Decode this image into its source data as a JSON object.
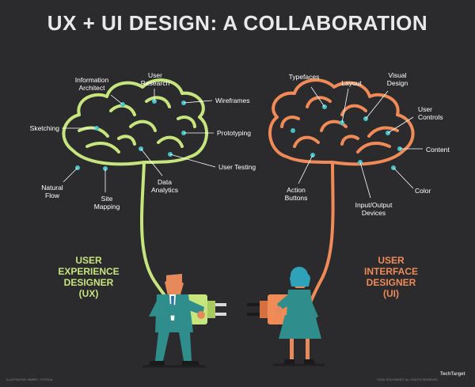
{
  "title": "UX + UI DESIGN: A COLLABORATION",
  "colors": {
    "background": "#2b2b2d",
    "ux_brain": "#c6e57d",
    "ui_brain": "#f08a57",
    "dot": "#46c2c6",
    "label": "#ffffff",
    "title": "#e9e9e9"
  },
  "ux": {
    "role_label": "USER\nEXPERIENCE\nDESIGNER\n(UX)",
    "labels": {
      "information_architect": "Information\nArchitect",
      "user_research": "User\nResearch",
      "wireframes": "Wireframes",
      "sketching": "Sketching",
      "prototyping": "Prototyping",
      "user_testing": "User Testing",
      "natural_flow": "Natural\nFlow",
      "site_mapping": "Site\nMapping",
      "data_analytics": "Data\nAnalytics"
    }
  },
  "ui": {
    "role_label": "USER\nINTERFACE\nDESIGNER\n(UI)",
    "labels": {
      "typefaces": "Typefaces",
      "layout": "Layout",
      "visual_design": "Visual\nDesign",
      "user_controls": "User\nControls",
      "content": "Content",
      "action_buttons": "Action\nButtons",
      "input_output_devices": "Input/Output\nDevices",
      "color": "Color"
    }
  },
  "footer": {
    "left": "ILLUSTRATION: SIMMET / FOTOLIA",
    "right": "©2016 TECHTARGET. ALL RIGHTS RESERVED.",
    "brand": "TechTarget"
  }
}
